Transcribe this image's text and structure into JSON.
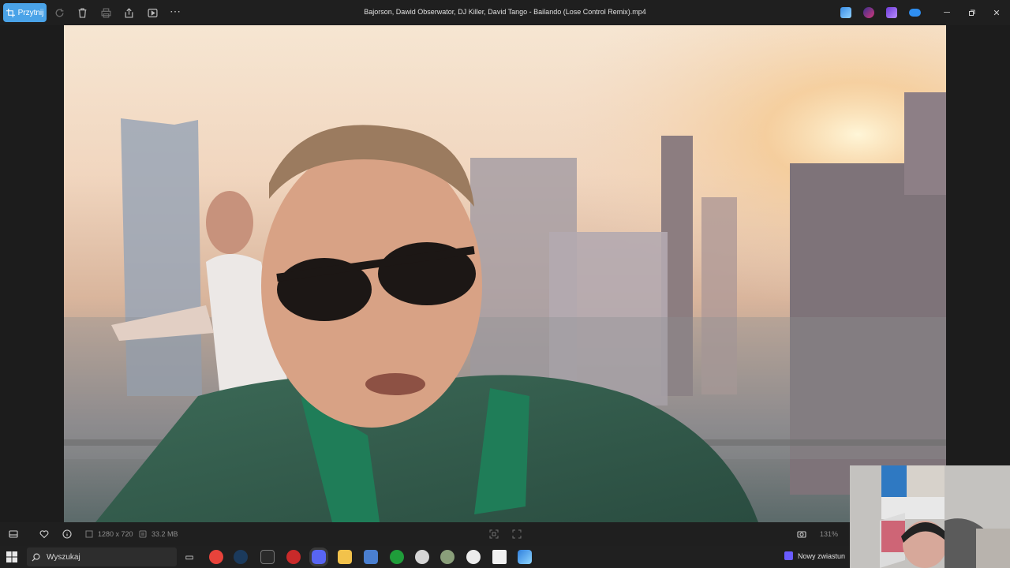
{
  "titlebar": {
    "crop_label": "Przytnij",
    "title": "Bajorson, Dawid Obserwator, DJ Killer, David Tango - Bailando (Lose Control Remix).mp4"
  },
  "bottombar": {
    "dimensions": "1280 x 720",
    "file_size": "33.2 MB",
    "zoom": "131%"
  },
  "taskbar": {
    "search_placeholder": "Wyszukaj",
    "news_label": "Nowy zwiastun"
  },
  "colors": {
    "accent": "#4aa3e8",
    "background": "#1c1c1c",
    "bar": "#1f1f1f"
  }
}
